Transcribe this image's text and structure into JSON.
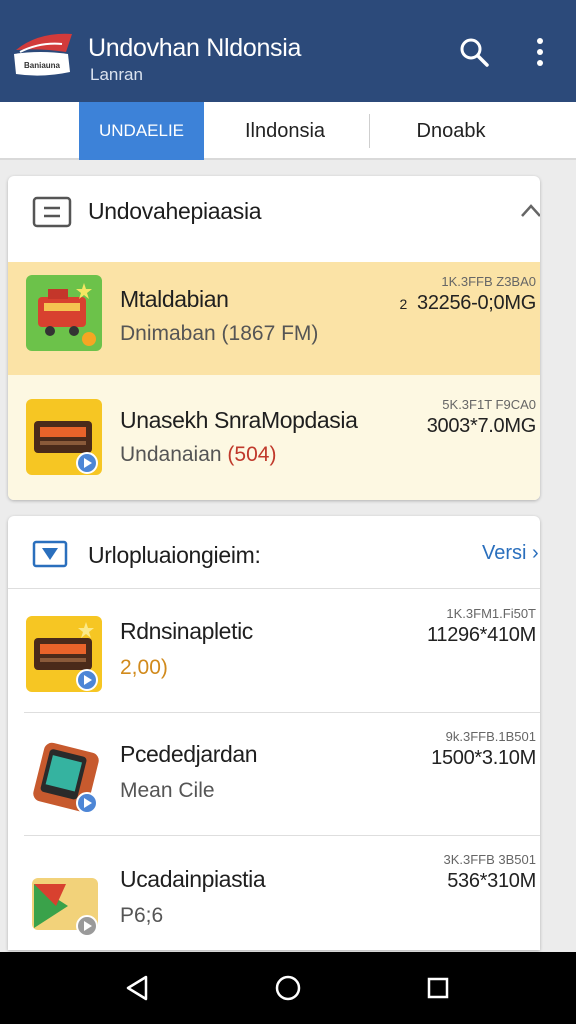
{
  "appbar": {
    "title": "Undovhan Nldonsia",
    "subtitle": "Lanran",
    "logo_text": "Baniauna",
    "actions": [
      "search-icon",
      "more-vert-icon"
    ]
  },
  "tabs": [
    {
      "label": "UNDAELIE",
      "active": true
    },
    {
      "label": "Ilndonsia",
      "active": false
    },
    {
      "label": "Dnoabk",
      "active": false
    }
  ],
  "colors": {
    "appbar": "#2c4a7a",
    "tab_active": "#3d82d8",
    "highlight_row": "#fbe3a6",
    "secondary_row": "#fdf8e2",
    "link": "#2a6fbd",
    "accent_red": "#c0392b",
    "accent_orange": "#d18a1c"
  },
  "section1": {
    "title": "Undovahepiaasia",
    "header_icon": "list-box-icon",
    "collapse_icon": "chevron-up-icon",
    "items": [
      {
        "name": "Mtaldabian",
        "sub": "Dnimaban (1867 FM)",
        "meta_small": "1K.3FFB Z3BA0",
        "meta_big": "32256-0;0MG",
        "meta_prefix": "2",
        "icon": "train-app-icon",
        "highlight": true
      },
      {
        "name": "Unasekh SnraMopdasia",
        "sub_prefix": "Undanaian ",
        "sub_accent": "(504)",
        "meta_small": "5K.3F1T F9CA0",
        "meta_big": "3003*7.0MG",
        "icon": "bus-app-icon",
        "highlight": false
      }
    ]
  },
  "section2": {
    "title": "Urlopluaiongieim:",
    "header_icon": "video-folder-icon",
    "link": "Versi",
    "items": [
      {
        "name": "Rdnsinapletic",
        "sub": "2,00)",
        "sub_color": "accent_orange",
        "meta_small": "1K.3FM1.Fi50T",
        "meta_big": "11296*410M",
        "icon": "bus-app-icon"
      },
      {
        "name": "Pcededjardan",
        "sub": "Mean Cile",
        "meta_small": "9k.3FFB.1B501",
        "meta_big": "1500*3.10M",
        "icon": "tablet-app-icon"
      },
      {
        "name": "Ucadainpiastia",
        "sub": "P6;6",
        "meta_small": "3K.3FFB 3B501",
        "meta_big": "536*310M",
        "icon": "play-folder-icon"
      }
    ]
  },
  "navbar": {
    "buttons": [
      "back-icon",
      "home-icon",
      "recents-icon"
    ]
  }
}
